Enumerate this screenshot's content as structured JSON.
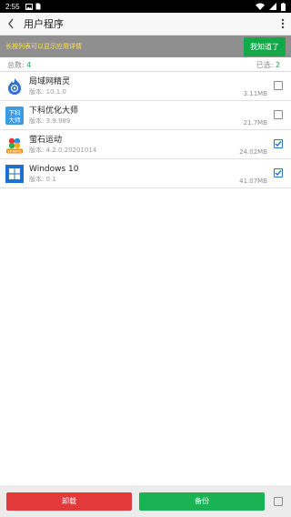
{
  "status_bar": {
    "time": "2:55",
    "left_icons": [
      "gallery-icon",
      "sim-icon"
    ],
    "right_icons": [
      "wifi-icon",
      "signal-icon",
      "battery-icon"
    ]
  },
  "app_bar": {
    "title": "用户程序"
  },
  "tip": {
    "text": "长按列表可以显示应用详情",
    "button": "我知道了"
  },
  "counts": {
    "total_label": "总数: ",
    "total_value": "4",
    "selected_label": "已选: ",
    "selected_value": "2"
  },
  "apps": [
    {
      "name": "局域网精灵",
      "version": "版本: 10.1.0",
      "size": "3.11MB",
      "checked": false
    },
    {
      "name": "下科优化大师",
      "version": "版本: 3.9.989",
      "size": "21.7MB",
      "checked": false,
      "icon_text": [
        "下科",
        "大师"
      ]
    },
    {
      "name": "萤石运动",
      "version": "版本: 4.2.0.20201014",
      "size": "24.02MB",
      "checked": true,
      "icon_text": [
        "SPORTS"
      ]
    },
    {
      "name": "Windows 10",
      "version": "版本: 0.1",
      "size": "41.07MB",
      "checked": true
    }
  ],
  "bottom": {
    "uninstall": "卸载",
    "backup": "备份"
  },
  "colors": {
    "tip_bg": "#8f8f8f",
    "tip_text": "#ffe14d",
    "ok_button": "#12a94a",
    "uninstall": "#e23a3a",
    "backup": "#19b354",
    "check": "#1976d2"
  }
}
